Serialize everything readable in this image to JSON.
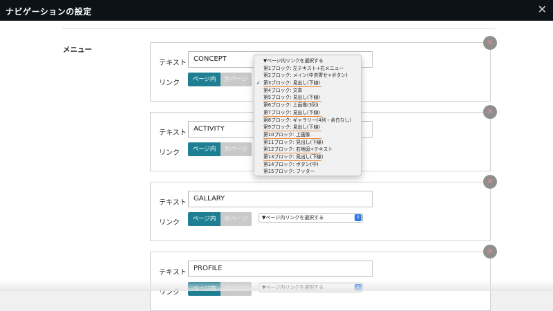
{
  "window": {
    "title": "ナビゲーションの設定"
  },
  "section": {
    "menu_label": "メニュー"
  },
  "labels": {
    "text": "テキスト",
    "link": "リンク",
    "page_inner": "ページ内",
    "other_page": "別ページ"
  },
  "select_placeholder": "▼ページ内リンクを選択する",
  "items": [
    {
      "text": "CONCEPT"
    },
    {
      "text": "ACTIVITY"
    },
    {
      "text": "GALLARY",
      "select": "▼ページ内リンクを選択する"
    },
    {
      "text": "PROFILE",
      "select": "▼ページ内リンクを選択する"
    }
  ],
  "dropdown": {
    "options": [
      {
        "label": "▼ページ内リンクを選択する"
      },
      {
        "label": "第1ブロック: 左テキスト+右メニュー"
      },
      {
        "label": "第2ブロック: メイン(中央寄せ+ボタン)"
      },
      {
        "label": "第3ブロック: 見出し(下線)",
        "selected": true,
        "underline": true
      },
      {
        "label": "第4ブロック: 文章"
      },
      {
        "label": "第5ブロック: 見出し(下線)",
        "underline": true
      },
      {
        "label": "第6ブロック: 上画像(3列)"
      },
      {
        "label": "第7ブロック: 見出し(下線)",
        "underline": true
      },
      {
        "label": "第8ブロック: ギャラリー(4列・余白なし)"
      },
      {
        "label": "第9ブロック: 見出し(下線)",
        "underline": true
      },
      {
        "label": "第10ブロック: 上画像",
        "underline": true
      },
      {
        "label": "第11ブロック: 見出し(下線)"
      },
      {
        "label": "第12ブロック: 右地図+テキスト",
        "underline": true
      },
      {
        "label": "第13ブロック: 見出し(下線)",
        "underline": true
      },
      {
        "label": "第14ブロック: ボタン(中)"
      },
      {
        "label": "第15ブロック: フッター"
      }
    ]
  },
  "colors": {
    "titlebar": "#0b1316",
    "accent": "#1e7f93",
    "highlight_underline": "#e8893a",
    "delete_icon": "#e8908f"
  }
}
